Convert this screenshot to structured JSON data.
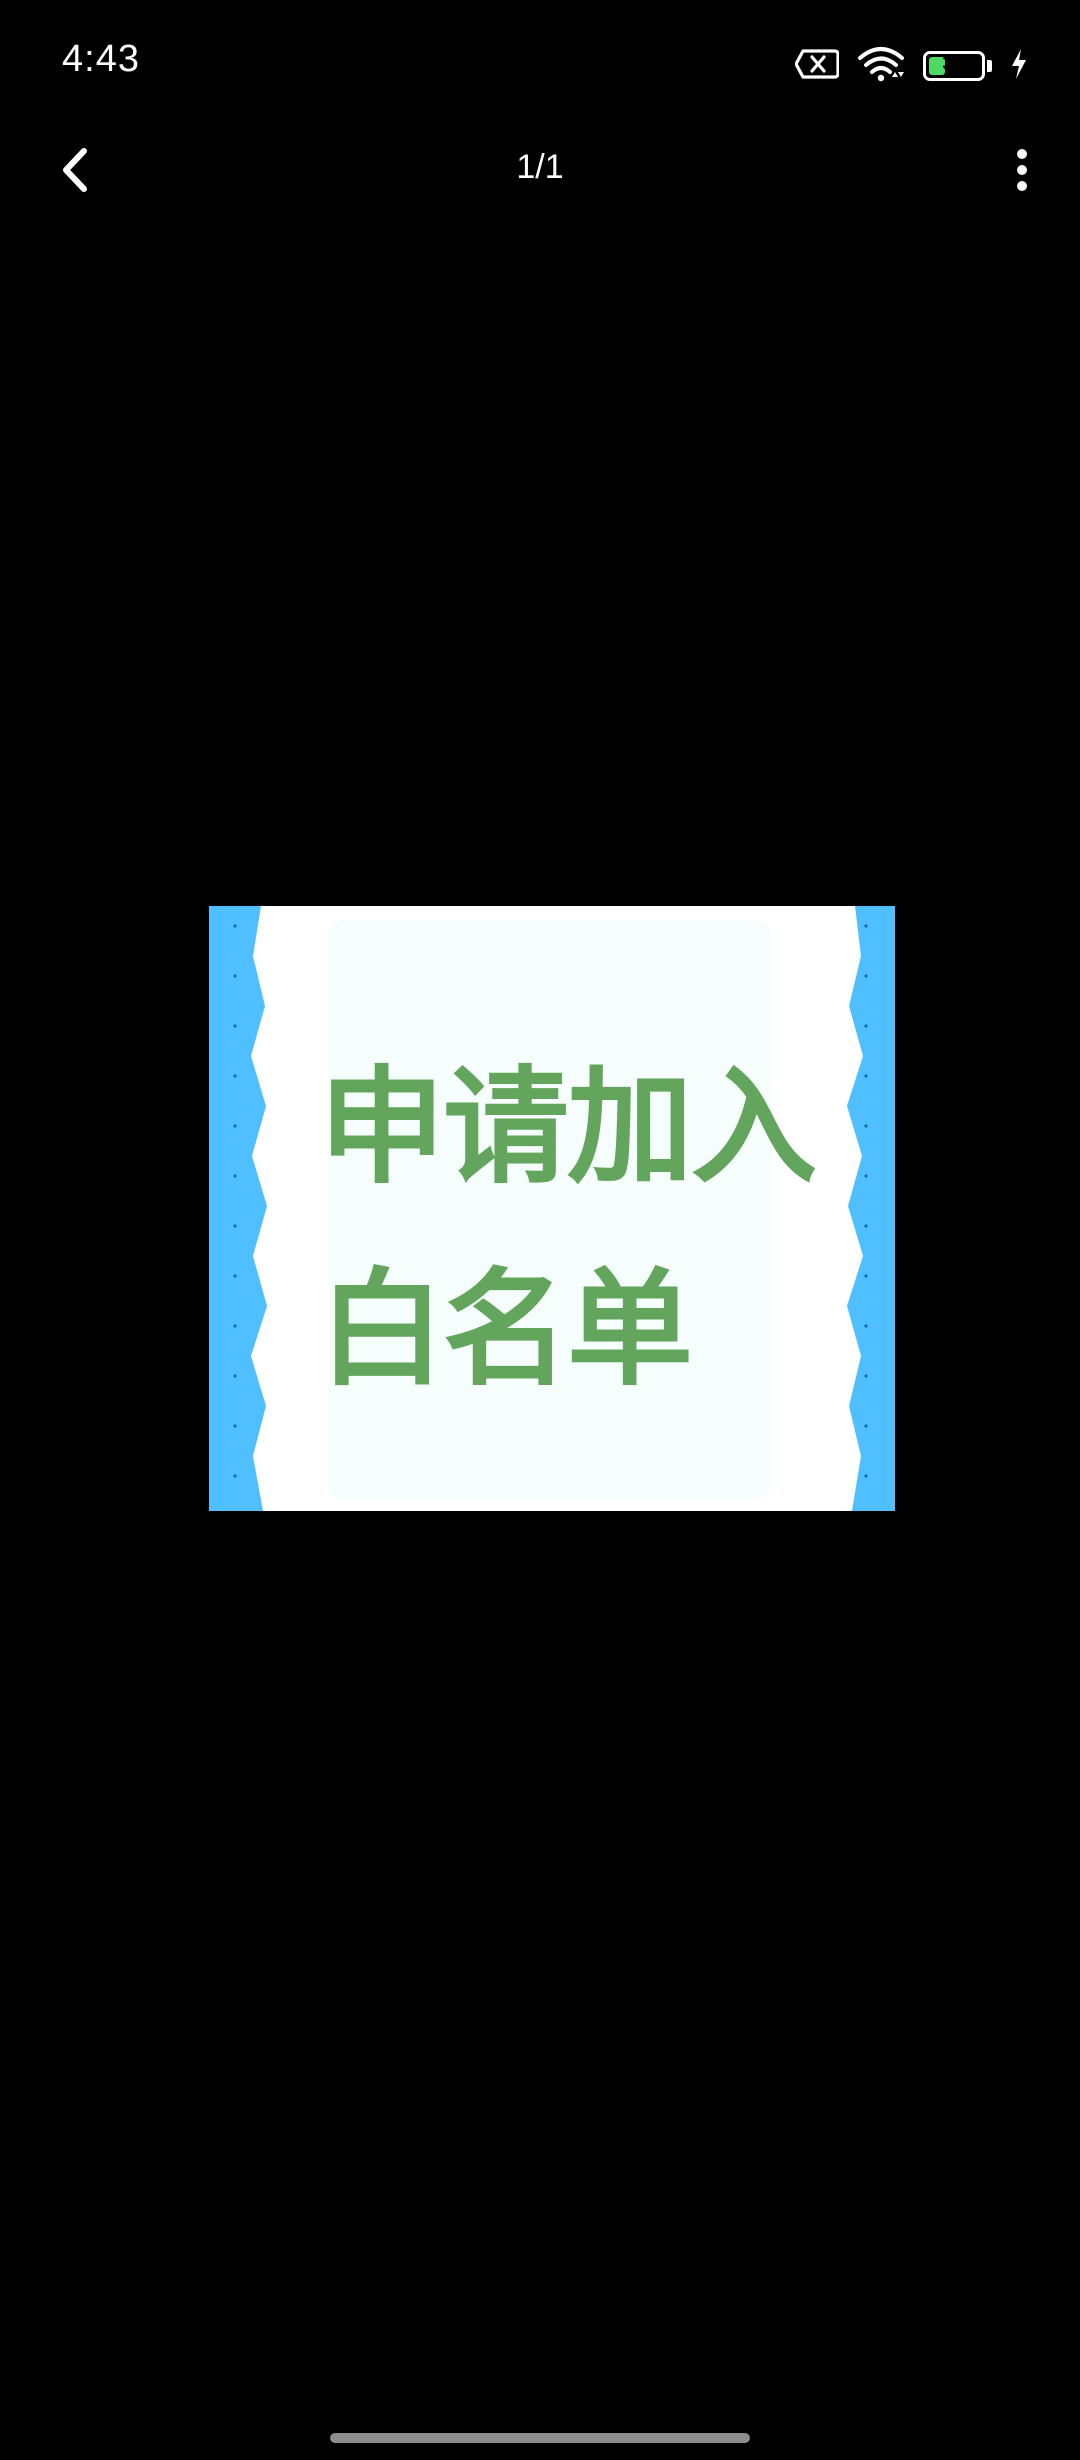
{
  "status_bar": {
    "time": "4:43",
    "battery_level": "32",
    "battery_fraction": 0.32,
    "icons": [
      "sim-error-icon",
      "wifi-icon",
      "battery-icon",
      "charging-bolt-icon"
    ]
  },
  "top_bar": {
    "page_indicator": "1/1",
    "icons": [
      "back-arrow-icon",
      "more-vertical-icon"
    ]
  },
  "image": {
    "line1": "申请加入",
    "line2": "白名单",
    "colors": {
      "text": "#63a55d",
      "side_strip": "#4fbfff",
      "background": "#ffffff",
      "inner": "#f6fefd"
    }
  },
  "colors": {
    "screen_background": "#000000",
    "battery_fill": "#4cd964"
  }
}
